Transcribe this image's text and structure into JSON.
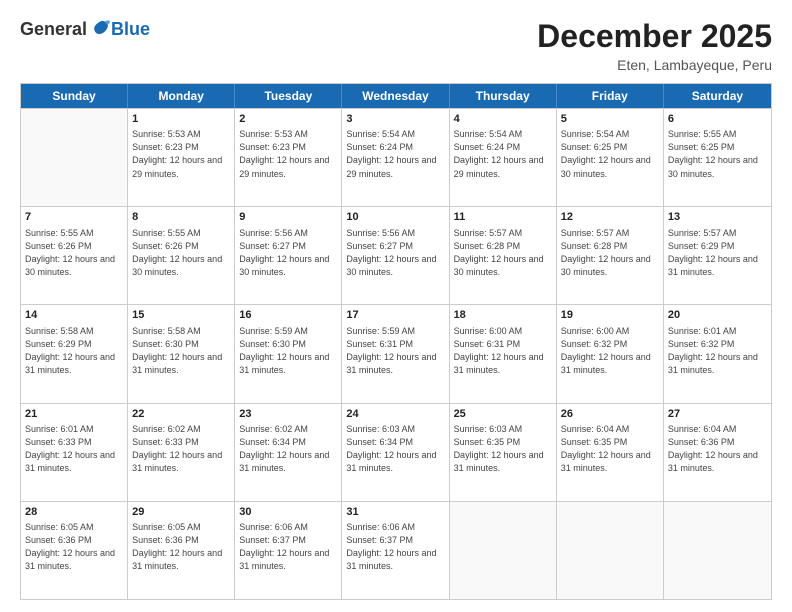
{
  "header": {
    "logo_general": "General",
    "logo_blue": "Blue",
    "main_title": "December 2025",
    "subtitle": "Eten, Lambayeque, Peru"
  },
  "calendar": {
    "days_of_week": [
      "Sunday",
      "Monday",
      "Tuesday",
      "Wednesday",
      "Thursday",
      "Friday",
      "Saturday"
    ],
    "weeks": [
      [
        {
          "day": "",
          "empty": true
        },
        {
          "day": "1",
          "sunrise": "5:53 AM",
          "sunset": "6:23 PM",
          "daylight": "12 hours and 29 minutes."
        },
        {
          "day": "2",
          "sunrise": "5:53 AM",
          "sunset": "6:23 PM",
          "daylight": "12 hours and 29 minutes."
        },
        {
          "day": "3",
          "sunrise": "5:54 AM",
          "sunset": "6:24 PM",
          "daylight": "12 hours and 29 minutes."
        },
        {
          "day": "4",
          "sunrise": "5:54 AM",
          "sunset": "6:24 PM",
          "daylight": "12 hours and 29 minutes."
        },
        {
          "day": "5",
          "sunrise": "5:54 AM",
          "sunset": "6:25 PM",
          "daylight": "12 hours and 30 minutes."
        },
        {
          "day": "6",
          "sunrise": "5:55 AM",
          "sunset": "6:25 PM",
          "daylight": "12 hours and 30 minutes."
        }
      ],
      [
        {
          "day": "7",
          "sunrise": "5:55 AM",
          "sunset": "6:26 PM",
          "daylight": "12 hours and 30 minutes."
        },
        {
          "day": "8",
          "sunrise": "5:55 AM",
          "sunset": "6:26 PM",
          "daylight": "12 hours and 30 minutes."
        },
        {
          "day": "9",
          "sunrise": "5:56 AM",
          "sunset": "6:27 PM",
          "daylight": "12 hours and 30 minutes."
        },
        {
          "day": "10",
          "sunrise": "5:56 AM",
          "sunset": "6:27 PM",
          "daylight": "12 hours and 30 minutes."
        },
        {
          "day": "11",
          "sunrise": "5:57 AM",
          "sunset": "6:28 PM",
          "daylight": "12 hours and 30 minutes."
        },
        {
          "day": "12",
          "sunrise": "5:57 AM",
          "sunset": "6:28 PM",
          "daylight": "12 hours and 30 minutes."
        },
        {
          "day": "13",
          "sunrise": "5:57 AM",
          "sunset": "6:29 PM",
          "daylight": "12 hours and 31 minutes."
        }
      ],
      [
        {
          "day": "14",
          "sunrise": "5:58 AM",
          "sunset": "6:29 PM",
          "daylight": "12 hours and 31 minutes."
        },
        {
          "day": "15",
          "sunrise": "5:58 AM",
          "sunset": "6:30 PM",
          "daylight": "12 hours and 31 minutes."
        },
        {
          "day": "16",
          "sunrise": "5:59 AM",
          "sunset": "6:30 PM",
          "daylight": "12 hours and 31 minutes."
        },
        {
          "day": "17",
          "sunrise": "5:59 AM",
          "sunset": "6:31 PM",
          "daylight": "12 hours and 31 minutes."
        },
        {
          "day": "18",
          "sunrise": "6:00 AM",
          "sunset": "6:31 PM",
          "daylight": "12 hours and 31 minutes."
        },
        {
          "day": "19",
          "sunrise": "6:00 AM",
          "sunset": "6:32 PM",
          "daylight": "12 hours and 31 minutes."
        },
        {
          "day": "20",
          "sunrise": "6:01 AM",
          "sunset": "6:32 PM",
          "daylight": "12 hours and 31 minutes."
        }
      ],
      [
        {
          "day": "21",
          "sunrise": "6:01 AM",
          "sunset": "6:33 PM",
          "daylight": "12 hours and 31 minutes."
        },
        {
          "day": "22",
          "sunrise": "6:02 AM",
          "sunset": "6:33 PM",
          "daylight": "12 hours and 31 minutes."
        },
        {
          "day": "23",
          "sunrise": "6:02 AM",
          "sunset": "6:34 PM",
          "daylight": "12 hours and 31 minutes."
        },
        {
          "day": "24",
          "sunrise": "6:03 AM",
          "sunset": "6:34 PM",
          "daylight": "12 hours and 31 minutes."
        },
        {
          "day": "25",
          "sunrise": "6:03 AM",
          "sunset": "6:35 PM",
          "daylight": "12 hours and 31 minutes."
        },
        {
          "day": "26",
          "sunrise": "6:04 AM",
          "sunset": "6:35 PM",
          "daylight": "12 hours and 31 minutes."
        },
        {
          "day": "27",
          "sunrise": "6:04 AM",
          "sunset": "6:36 PM",
          "daylight": "12 hours and 31 minutes."
        }
      ],
      [
        {
          "day": "28",
          "sunrise": "6:05 AM",
          "sunset": "6:36 PM",
          "daylight": "12 hours and 31 minutes."
        },
        {
          "day": "29",
          "sunrise": "6:05 AM",
          "sunset": "6:36 PM",
          "daylight": "12 hours and 31 minutes."
        },
        {
          "day": "30",
          "sunrise": "6:06 AM",
          "sunset": "6:37 PM",
          "daylight": "12 hours and 31 minutes."
        },
        {
          "day": "31",
          "sunrise": "6:06 AM",
          "sunset": "6:37 PM",
          "daylight": "12 hours and 31 minutes."
        },
        {
          "day": "",
          "empty": true
        },
        {
          "day": "",
          "empty": true
        },
        {
          "day": "",
          "empty": true
        }
      ]
    ]
  }
}
